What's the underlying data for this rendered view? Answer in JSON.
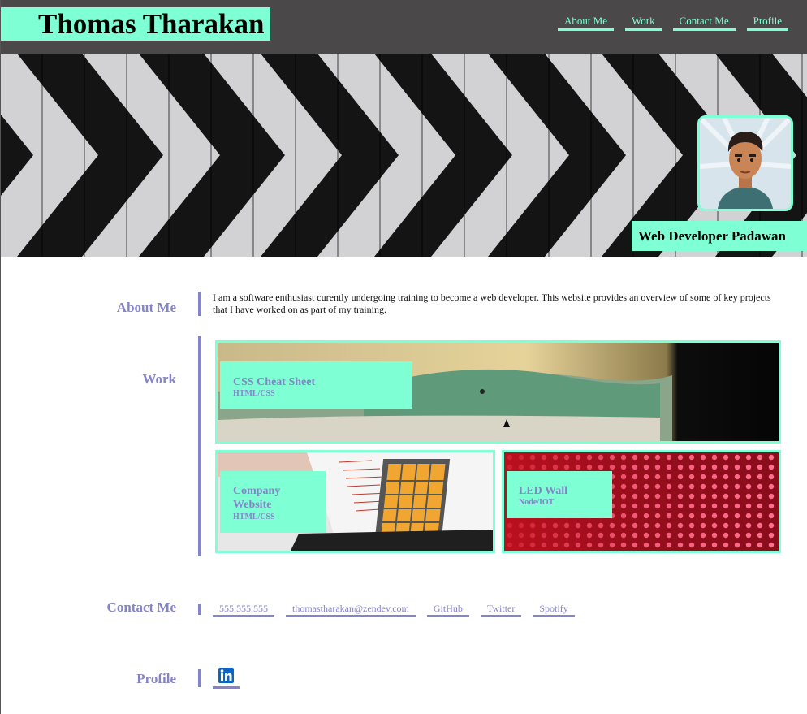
{
  "header": {
    "site_title": "Thomas Tharakan",
    "nav": [
      "About Me",
      "Work",
      "Contact Me",
      "Profile"
    ]
  },
  "hero": {
    "tagline": "Web Developer Padawan"
  },
  "about": {
    "label": "About Me",
    "text": "I am a software enthusiast curently undergoing training to become a web developer. This website provides an overview of some of key projects that I have worked on as part of my training."
  },
  "work": {
    "label": "Work",
    "projects": [
      {
        "title": "CSS Cheat Sheet",
        "tech": "HTML/CSS"
      },
      {
        "title": "Company Website",
        "tech": "HTML/CSS"
      },
      {
        "title": "LED Wall",
        "tech": "Node/IOT"
      }
    ]
  },
  "contact": {
    "label": "Contact Me",
    "links": [
      "555.555.555",
      "thomastharakan@zendev.com",
      "GitHub",
      "Twitter",
      "Spotify"
    ]
  },
  "profile": {
    "label": "Profile",
    "icon": "linkedin-icon"
  },
  "colors": {
    "accent": "#7fffd4",
    "label": "#8584c8",
    "header_bg": "#4a4849"
  }
}
